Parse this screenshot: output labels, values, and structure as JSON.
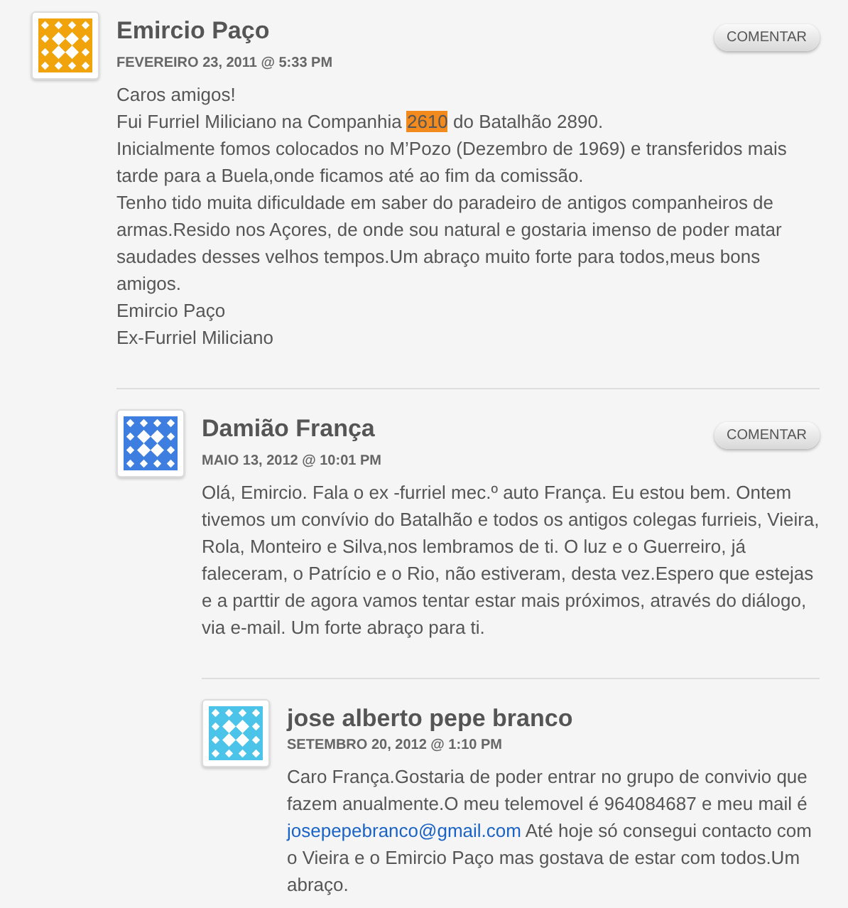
{
  "comments": [
    {
      "author": "Emircio Paço",
      "date": "FEVEREIRO 23, 2011 @ 5:33 PM",
      "color": "#f0a30a",
      "reply_button": "COMENTAR",
      "paragraphs": [
        [
          {
            "kind": "text",
            "text": "Caros amigos!"
          }
        ],
        [
          {
            "kind": "text",
            "text": "Fui Furriel Miliciano na Companhia "
          },
          {
            "kind": "highlight",
            "text": "2610"
          },
          {
            "kind": "text",
            "text": " do Batalhão 2890."
          }
        ],
        [
          {
            "kind": "text",
            "text": "Inicialmente fomos colocados no M’Pozo (Dezembro de 1969) e transferidos mais tarde para a Buela,onde ficamos até ao fim da comissão."
          }
        ],
        [
          {
            "kind": "text",
            "text": "Tenho tido muita dificuldade em saber do paradeiro de antigos companheiros de armas.Resido nos Açores, de onde sou natural e gostaria imenso de poder matar saudades desses velhos tempos.Um abraço muito forte para todos,meus bons amigos."
          }
        ],
        [
          {
            "kind": "text",
            "text": "Emircio Paço"
          }
        ],
        [
          {
            "kind": "text",
            "text": "Ex-Furriel Miliciano"
          }
        ]
      ],
      "children": [
        {
          "author": "Damião França",
          "date": "MAIO 13, 2012 @ 10:01 PM",
          "color": "#3d7ee0",
          "reply_button": "COMENTAR",
          "paragraphs": [
            [
              {
                "kind": "text",
                "text": "Olá, Emircio. Fala o ex -furriel mec.º auto França. Eu estou bem. Ontem tivemos um convívio do Batalhão e todos os antigos colegas furrieis, Vieira, Rola, Monteiro e Silva,nos lembramos de ti. O luz e o Guerreiro, já faleceram, o Patrício e o Rio, não estiveram, desta vez.Espero que estejas e a parttir de agora vamos tentar estar mais próximos, através do diálogo, via e-mail. Um forte abraço para ti."
              }
            ]
          ],
          "children": [
            {
              "author": "jose alberto pepe branco",
              "date": "SETEMBRO 20, 2012 @ 1:10 PM",
              "color": "#4cc3e8",
              "paragraphs": [
                [
                  {
                    "kind": "text",
                    "text": "Caro França.Gostaria de poder entrar no grupo de convivio que fazem anualmente.O meu telemovel é 964084687 e meu mail é "
                  },
                  {
                    "kind": "link",
                    "text": "josepepebranco@gmail.com"
                  },
                  {
                    "kind": "text",
                    "text": " Até hoje só consegui contacto com o Vieira e o Emircio Paço mas gostava de estar com todos.Um abraço."
                  }
                ]
              ]
            }
          ]
        }
      ]
    }
  ]
}
